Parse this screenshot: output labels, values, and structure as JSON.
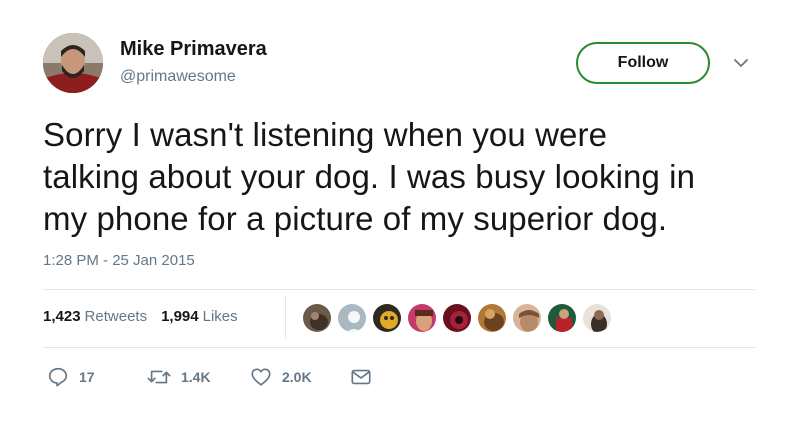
{
  "user": {
    "name": "Mike Primavera",
    "handle": "@primawesome",
    "avatar_icon": "profile-photo"
  },
  "header": {
    "follow_label": "Follow",
    "menu_icon": "chevron-down-icon"
  },
  "tweet": {
    "line1": "Sorry I wasn't listening when you were",
    "line2": "talking about your dog. I was busy looking in",
    "line3": "my phone for a picture of my superior dog.",
    "timestamp": "1:28 PM - 25 Jan 2015"
  },
  "stats": {
    "retweets_count": "1,423",
    "retweets_label": "Retweets",
    "likes_count": "1,994",
    "likes_label": "Likes"
  },
  "actions": {
    "reply_count": "17",
    "retweet_count": "1.4K",
    "like_count": "2.0K"
  },
  "colors": {
    "follow_border": "#2a8a2e",
    "muted_text": "#657786",
    "primary_text": "#14171a",
    "divider": "#e1e8ed"
  }
}
